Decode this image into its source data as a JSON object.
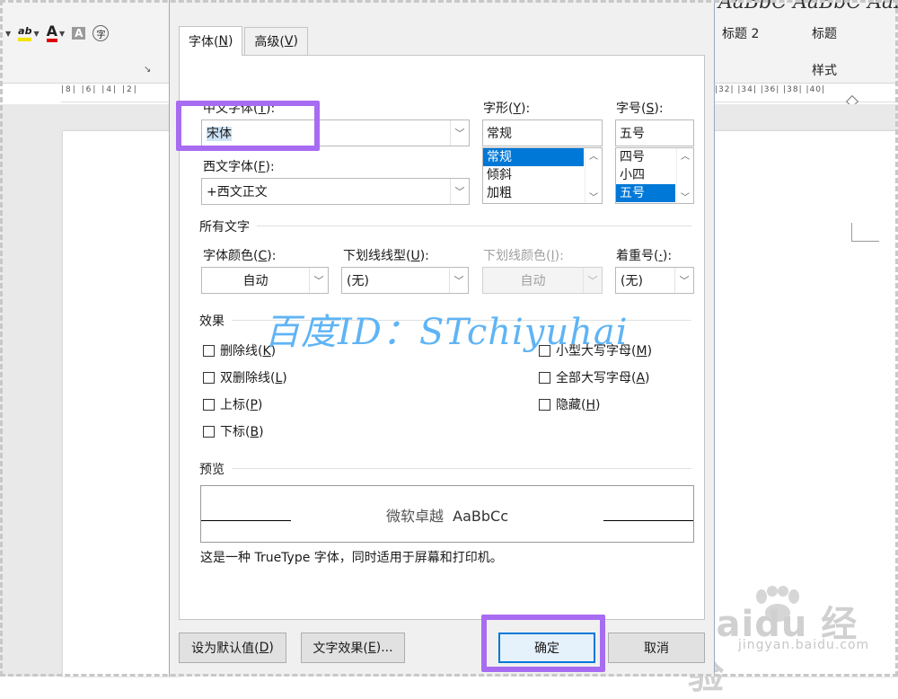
{
  "background": {
    "ribbon_styles_sample": "AaBbC AaBbC AaBbC",
    "style_names": [
      "标题 2",
      "标题"
    ],
    "styles_label": "样式",
    "ruler_left": "|8|  |6|  |4|  |2|",
    "ruler_right": "|32|  |34|  |36|  |38|  |40|",
    "baidu_logo": "Baidu 经验",
    "baidu_url": "jingyan.baidu.com"
  },
  "dialog": {
    "tabs": [
      {
        "label": "字体(",
        "key": "N",
        "tail": ")",
        "active": true
      },
      {
        "label": "高级(",
        "key": "V",
        "tail": ")",
        "active": false
      }
    ],
    "cn_font": {
      "label": "中文字体(",
      "key": "T",
      "tail": "):",
      "value": "宋体"
    },
    "west_font": {
      "label": "西文字体(",
      "key": "F",
      "tail": "):",
      "value": "+西文正文"
    },
    "style": {
      "label": "字形(",
      "key": "Y",
      "tail": "):",
      "value": "常规",
      "options": [
        "常规",
        "倾斜",
        "加粗"
      ],
      "selected": 0
    },
    "size": {
      "label": "字号(",
      "key": "S",
      "tail": "):",
      "value": "五号",
      "options": [
        "四号",
        "小四",
        "五号"
      ],
      "selected": 2
    },
    "all_text_label": "所有文字",
    "font_color": {
      "label": "字体颜色(",
      "key": "C",
      "tail": "):",
      "value": "自动"
    },
    "underline": {
      "label": "下划线线型(",
      "key": "U",
      "tail": "):",
      "value": "(无)"
    },
    "underline_color": {
      "label": "下划线颜色(",
      "key": "I",
      "tail": "):",
      "value": "自动"
    },
    "emphasis": {
      "label": "着重号(",
      "key": "·",
      "tail": "):",
      "value": "(无)"
    },
    "effects_label": "效果",
    "effects_left": [
      {
        "label": "删除线(",
        "key": "K",
        "tail": ")"
      },
      {
        "label": "双删除线(",
        "key": "L",
        "tail": ")"
      },
      {
        "label": "上标(",
        "key": "P",
        "tail": ")"
      },
      {
        "label": "下标(",
        "key": "B",
        "tail": ")"
      }
    ],
    "effects_right": [
      {
        "label": "小型大写字母(",
        "key": "M",
        "tail": ")"
      },
      {
        "label": "全部大写字母(",
        "key": "A",
        "tail": ")"
      },
      {
        "label": "隐藏(",
        "key": "H",
        "tail": ")"
      }
    ],
    "preview_label": "预览",
    "preview_cn": "微软卓越",
    "preview_en": "AaBbCc",
    "preview_note": "这是一种 TrueType 字体，同时适用于屏幕和打印机。",
    "buttons": {
      "set_default": {
        "label": "设为默认值(",
        "key": "D",
        "tail": ")"
      },
      "text_effects": {
        "label": "文字效果(",
        "key": "E",
        "tail": ")..."
      },
      "ok": "确定",
      "cancel": "取消"
    }
  },
  "watermark": "百度ID：STchiyuhai",
  "colors": {
    "highlight": "#a76cf1",
    "watermark": "#5fb4f5",
    "list_selection": "#0078d7",
    "font_color_underline": "#e00000",
    "highlight_color_underline": "#f2e300"
  }
}
